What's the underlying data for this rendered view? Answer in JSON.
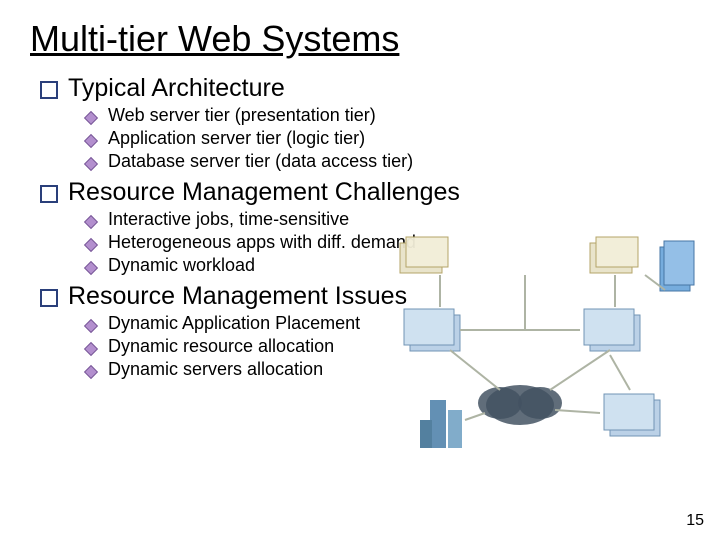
{
  "title": "Multi-tier Web Systems",
  "sections": [
    {
      "heading": "Typical Architecture",
      "items": [
        "Web server tier (presentation tier)",
        "Application server tier (logic tier)",
        "Database server tier (data access tier)"
      ]
    },
    {
      "heading": "Resource Management Challenges",
      "items": [
        "Interactive jobs, time-sensitive",
        "Heterogeneous apps with diff. demand",
        "Dynamic workload"
      ]
    },
    {
      "heading": "Resource Management Issues",
      "items": [
        "Dynamic Application Placement",
        "Dynamic resource allocation",
        "Dynamic servers allocation"
      ]
    }
  ],
  "page_number": "15"
}
